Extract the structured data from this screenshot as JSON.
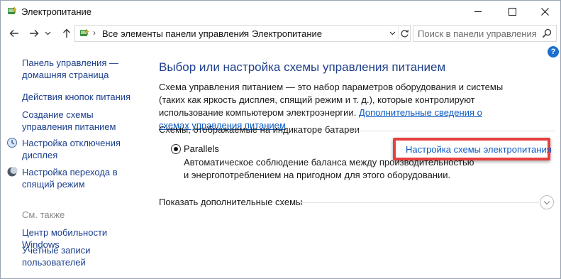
{
  "window": {
    "title": "Электропитание"
  },
  "address": {
    "crumbs": [
      "Все элементы панели управления",
      "Электропитание"
    ],
    "search_placeholder": "Поиск в панели управления"
  },
  "help_label": "?",
  "left_nav": {
    "items": [
      {
        "label": "Панель управления — домашняя страница"
      },
      {
        "label": "Действия кнопок питания"
      },
      {
        "label": "Создание схемы управления питанием"
      },
      {
        "label": "Настройка отключения дисплея"
      },
      {
        "label": "Настройка перехода в спящий режим"
      }
    ],
    "see_also": "См. также",
    "see_also_items": [
      {
        "label": "Центр мобильности Windows"
      },
      {
        "label": "Учетные записи пользователей"
      }
    ]
  },
  "main": {
    "heading": "Выбор или настройка схемы управления питанием",
    "description": "Схема управления питанием — это набор параметров оборудования и системы (таких как яркость дисплея, спящий режим и т. д.), которые контролируют использование компьютером электроэнергии.",
    "more_info_link": "Дополнительные сведения о схемах управления питанием",
    "plans_group": "Схемы, отображаемые на индикаторе батареи",
    "plan": {
      "name": "Parallels",
      "selected": true,
      "description": "Автоматическое соблюдение баланса между производительностью и энергопотреблением на пригодном для этого оборудовании.",
      "settings_link": "Настройка схемы электропитания"
    },
    "more_plans": "Показать дополнительные схемы"
  },
  "colors": {
    "link": "#0a58c2",
    "nav_link": "#1a3e8c",
    "heading": "#1e3f8a",
    "highlight_border": "#e84040"
  }
}
